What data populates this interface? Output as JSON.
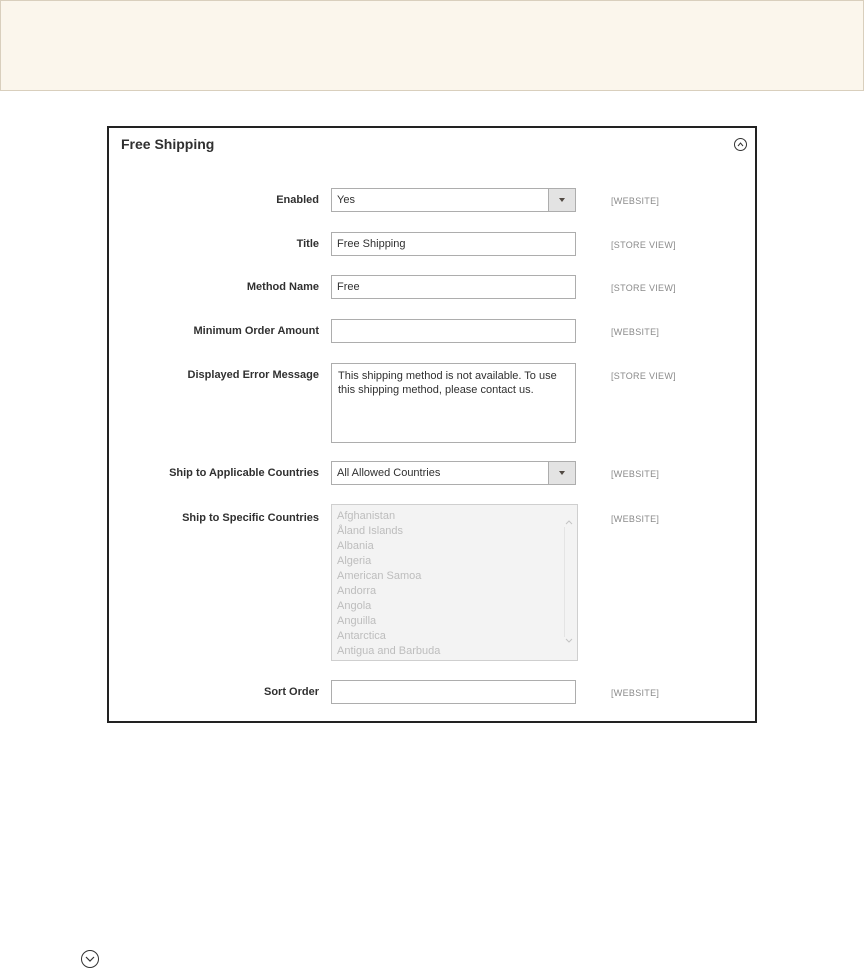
{
  "panel": {
    "title": "Free Shipping"
  },
  "fields": {
    "enabled": {
      "label": "Enabled",
      "value": "Yes",
      "scope": "[WEBSITE]"
    },
    "title": {
      "label": "Title",
      "value": "Free Shipping",
      "scope": "[STORE VIEW]"
    },
    "method_name": {
      "label": "Method Name",
      "value": "Free",
      "scope": "[STORE VIEW]"
    },
    "min_order": {
      "label": "Minimum Order Amount",
      "value": "",
      "scope": "[WEBSITE]"
    },
    "error_message": {
      "label": "Displayed Error Message",
      "value": "This shipping method is not available. To use this shipping method, please contact us.",
      "scope": "[STORE VIEW]"
    },
    "applicable_countries": {
      "label": "Ship to Applicable Countries",
      "value": "All Allowed Countries",
      "scope": "[WEBSITE]"
    },
    "specific_countries": {
      "label": "Ship to Specific Countries",
      "scope": "[WEBSITE]",
      "options": [
        "Afghanistan",
        "Åland Islands",
        "Albania",
        "Algeria",
        "American Samoa",
        "Andorra",
        "Angola",
        "Anguilla",
        "Antarctica",
        "Antigua and Barbuda"
      ]
    },
    "sort_order": {
      "label": "Sort Order",
      "value": "",
      "scope": "[WEBSITE]"
    }
  },
  "icons": {
    "collapse": "chevron-up-circle-icon",
    "expand": "chevron-down-circle-icon"
  },
  "colors": {
    "banner_bg": "#fbf6ec",
    "panel_border": "#222222",
    "disabled_bg": "#f3f3f3"
  }
}
